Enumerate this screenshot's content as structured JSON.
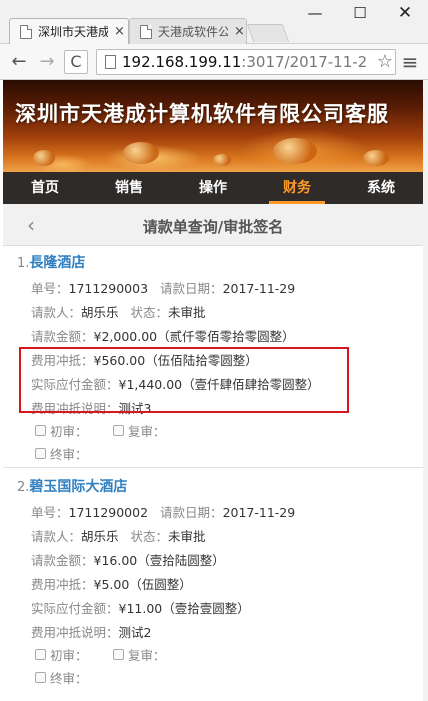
{
  "browser": {
    "tabs": [
      {
        "title": "深圳市天港成",
        "close": "×",
        "active": true
      },
      {
        "title": "天港成软件公",
        "close": "×",
        "active": false
      }
    ],
    "window_buttons": {
      "minimize": "—",
      "maximize": "☐",
      "close": "✕"
    },
    "nav": {
      "back": "←",
      "forward": "→",
      "reload": "C",
      "menu": "≡",
      "star": "☆"
    },
    "url_host": "192.168.199.11",
    "url_path": ":3017/2017-11-2"
  },
  "banner": {
    "title": "深圳市天港成计算机软件有限公司客服"
  },
  "mainnav": {
    "items": [
      "首页",
      "销售",
      "操作",
      "财务",
      "系统"
    ],
    "active_index": 3
  },
  "subheader": {
    "back": "‹",
    "title": "请款单查询/审批签名"
  },
  "records": [
    {
      "index": "1.",
      "name": "長隆酒店",
      "order_no_label": "单号：",
      "order_no": "1711290003",
      "date_label": "请款日期：",
      "date": "2017-11-29",
      "requester_label": "请款人：",
      "requester": "胡乐乐",
      "status_label": "状态：",
      "status": "未审批",
      "amount_label": "请款金额：",
      "amount": "¥2,000.00（贰仟零佰零拾零圆整）",
      "offset_label": "费用冲抵：",
      "offset": "¥560.00（伍佰陆拾零圆整）",
      "payable_label": "实际应付金额：",
      "payable": "¥1,440.00（壹仟肆佰肆拾零圆整）",
      "note_label": "费用冲抵说明：",
      "note": "测试3",
      "check1": "初审：",
      "check2": "复审：",
      "check3": "终审："
    },
    {
      "index": "2.",
      "name": "碧玉国际大酒店",
      "order_no_label": "单号：",
      "order_no": "1711290002",
      "date_label": "请款日期：",
      "date": "2017-11-29",
      "requester_label": "请款人：",
      "requester": "胡乐乐",
      "status_label": "状态：",
      "status": "未审批",
      "amount_label": "请款金额：",
      "amount": "¥16.00（壹拾陆圆整）",
      "offset_label": "费用冲抵：",
      "offset": "¥5.00（伍圆整）",
      "payable_label": "实际应付金额：",
      "payable": "¥11.00（壹拾壹圆整）",
      "note_label": "费用冲抵说明：",
      "note": "测试2",
      "check1": "初审：",
      "check2": "复审：",
      "check3": "终审："
    }
  ],
  "colors": {
    "accent": "#ff9a2a",
    "link": "#2f7fc1",
    "highlight": "#d6171e",
    "navbar": "#2e2b29"
  }
}
